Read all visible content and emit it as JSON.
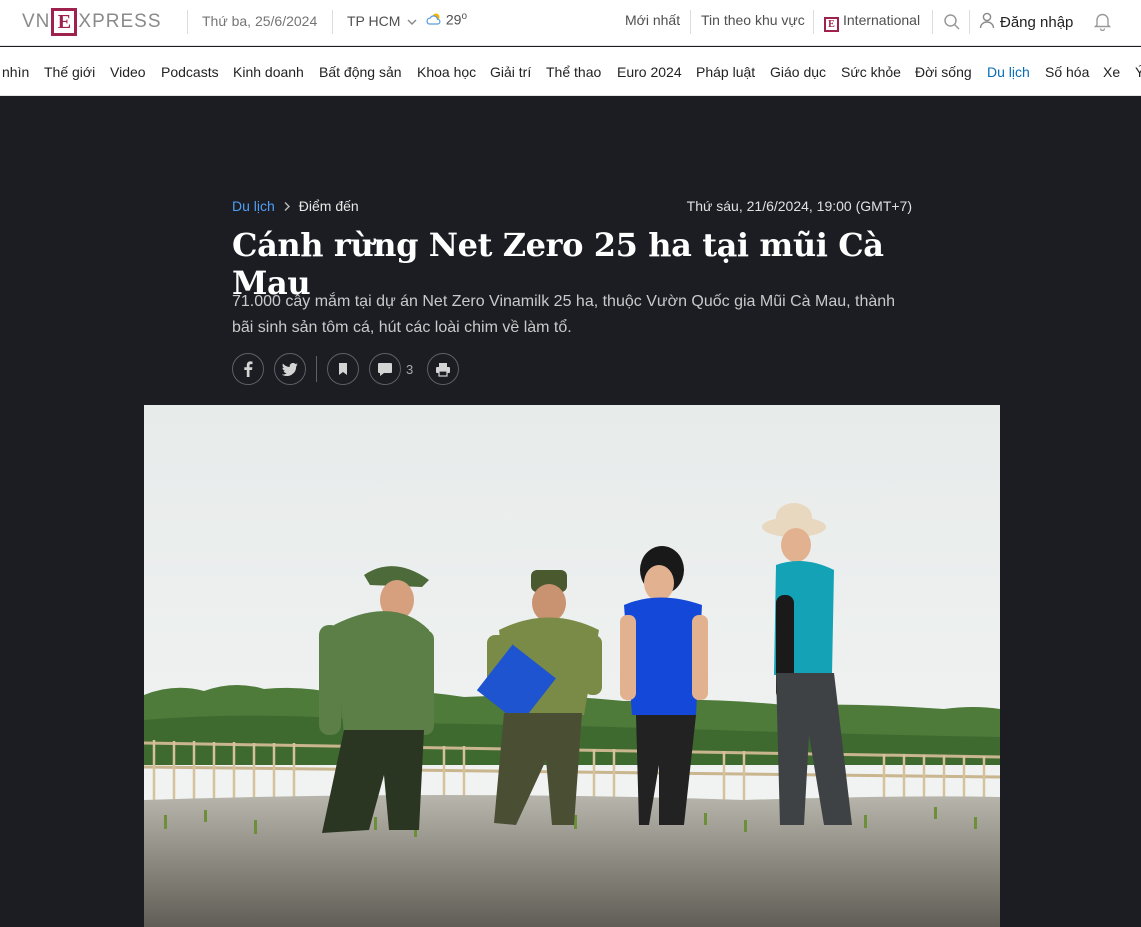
{
  "header": {
    "logo": {
      "left": "VN",
      "e": "E",
      "right": "XPRESS"
    },
    "date": "Thứ ba, 25/6/2024",
    "location": "TP HCM",
    "temperature": "29",
    "temp_unit": "o",
    "links": {
      "latest": "Mới nhất",
      "regional": "Tin theo khu vực",
      "international": "International",
      "login": "Đăng nhập"
    }
  },
  "nav": {
    "items": [
      "nhìn",
      "Thế giới",
      "Video",
      "Podcasts",
      "Kinh doanh",
      "Bất động sản",
      "Khoa học",
      "Giải trí",
      "Thể thao",
      "Euro 2024",
      "Pháp luật",
      "Giáo dục",
      "Sức khỏe",
      "Đời sống",
      "Du lịch",
      "Số hóa",
      "Xe",
      "Ý"
    ]
  },
  "article": {
    "breadcrumb": {
      "category": "Du lịch",
      "subcategory": "Điểm đến"
    },
    "published": "Thứ sáu, 21/6/2024, 19:00 (GMT+7)",
    "title": "Cánh rừng Net Zero 25 ha tại mũi Cà Mau",
    "lead": "71.000 cây mắm tại dự án Net Zero Vinamilk 25 ha, thuộc Vườn Quốc gia Mũi Cà Mau, thành bãi sinh sản tôm cá, hút các loài chim về làm tổ.",
    "comment_count": "3",
    "share_icons": [
      "facebook-icon",
      "twitter-icon",
      "bookmark-icon",
      "comment-icon",
      "print-icon"
    ]
  },
  "colors": {
    "accent": "#9f224e",
    "active_nav": "#076db6",
    "background": "#1b1d22",
    "link": "#4f9ef3"
  }
}
